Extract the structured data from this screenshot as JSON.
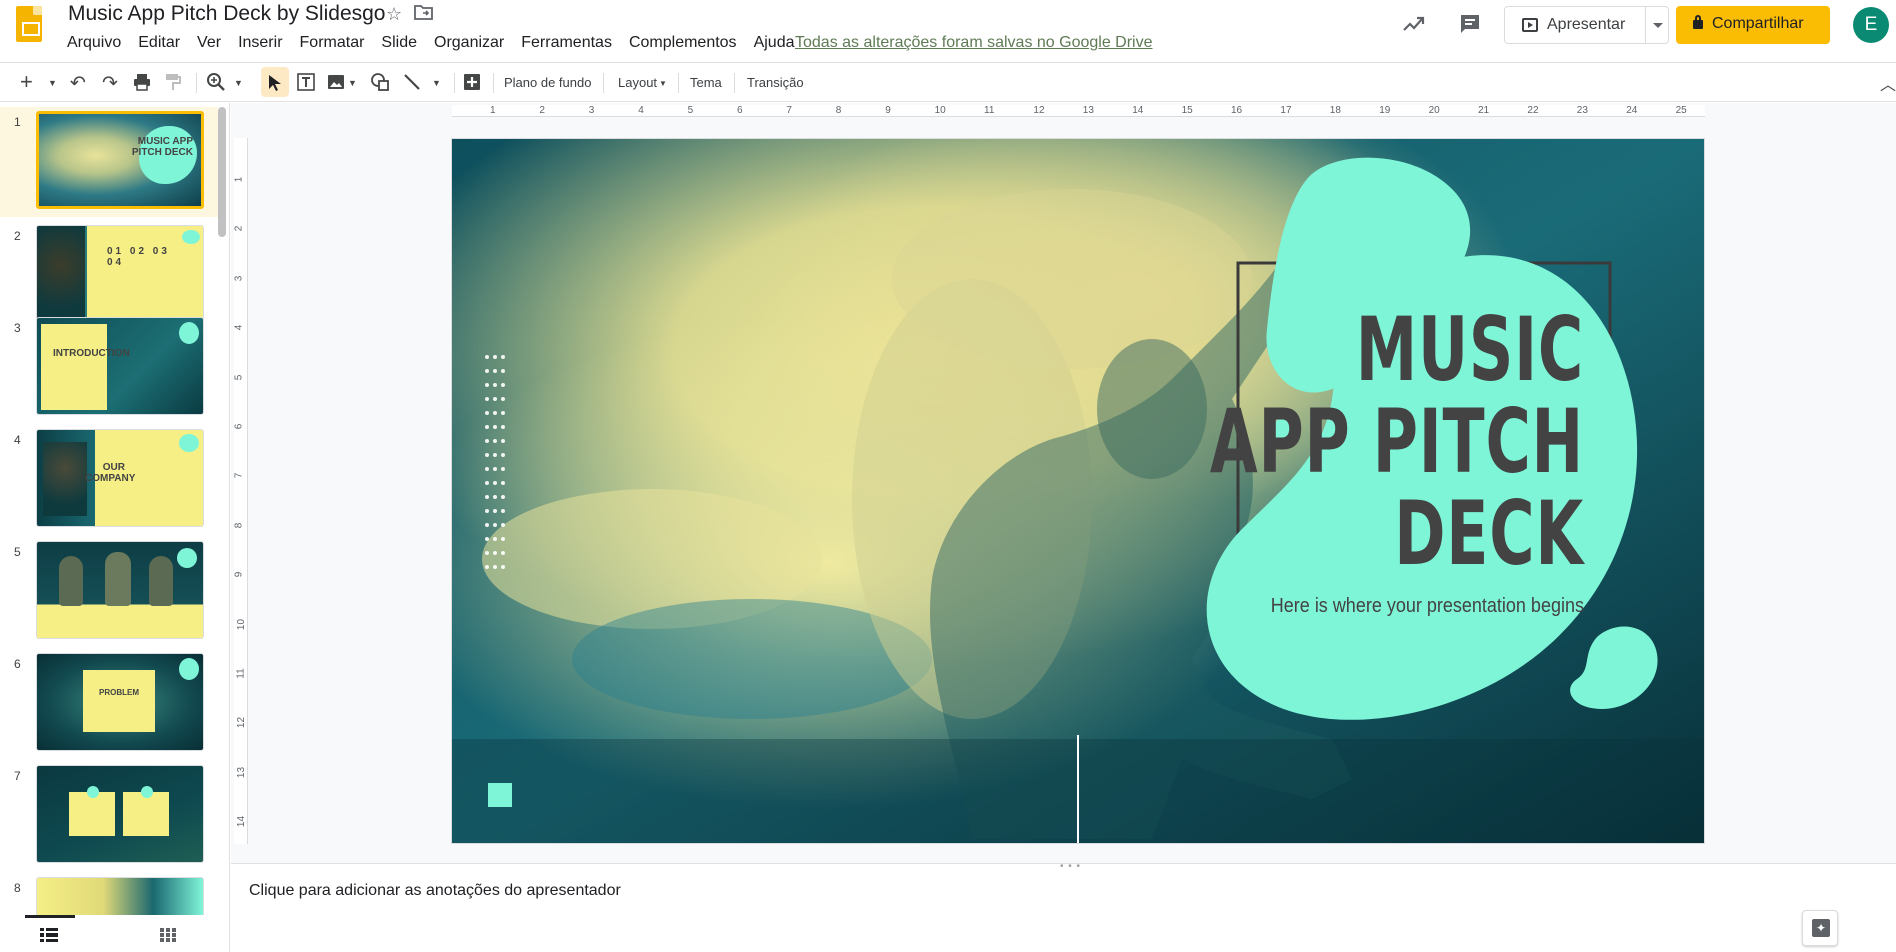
{
  "header": {
    "doc_title": "Music App Pitch Deck by Slidesgo",
    "save_status": "Todas as alterações foram salvas no Google Drive",
    "menu": [
      "Arquivo",
      "Editar",
      "Ver",
      "Inserir",
      "Formatar",
      "Slide",
      "Organizar",
      "Ferramentas",
      "Complementos",
      "Ajuda"
    ],
    "present_label": "Apresentar",
    "share_label": "Compartilhar",
    "avatar_letter": "E"
  },
  "toolbar": {
    "background_label": "Plano de fundo",
    "layout_label": "Layout",
    "theme_label": "Tema",
    "transition_label": "Transição"
  },
  "rulers": {
    "horizontal": [
      "1",
      "2",
      "3",
      "4",
      "5",
      "6",
      "7",
      "8",
      "9",
      "10",
      "11",
      "12",
      "13",
      "14",
      "15",
      "16",
      "17",
      "18",
      "19",
      "20",
      "21",
      "22",
      "23",
      "24",
      "25"
    ],
    "vertical": [
      "1",
      "2",
      "3",
      "4",
      "5",
      "6",
      "7",
      "8",
      "9",
      "10",
      "11",
      "12",
      "13",
      "14"
    ]
  },
  "filmstrip": {
    "slides": [
      {
        "number": "1",
        "thumb_text": "MUSIC APP PITCH DECK"
      },
      {
        "number": "2",
        "thumb_text": "01 02 03 04"
      },
      {
        "number": "3",
        "thumb_text": "INTRODUCTION"
      },
      {
        "number": "4",
        "thumb_text": "OUR COMPANY"
      },
      {
        "number": "5",
        "thumb_text": ""
      },
      {
        "number": "6",
        "thumb_text": "PROBLEM"
      },
      {
        "number": "7",
        "thumb_text": ""
      },
      {
        "number": "8",
        "thumb_text": ""
      }
    ],
    "active_index": 0
  },
  "slide": {
    "title_lines": [
      "MUSIC",
      "APP PITCH",
      "DECK"
    ],
    "subtitle": "Here is where your presentation begins"
  },
  "notes": {
    "placeholder": "Clique para adicionar as anotações do apresentador"
  },
  "colors": {
    "accent_mint": "#7ff5d8",
    "smoke_yellow": "#ece79a",
    "deep_teal": "#0e4a55",
    "share_yellow": "#fbbc04"
  }
}
